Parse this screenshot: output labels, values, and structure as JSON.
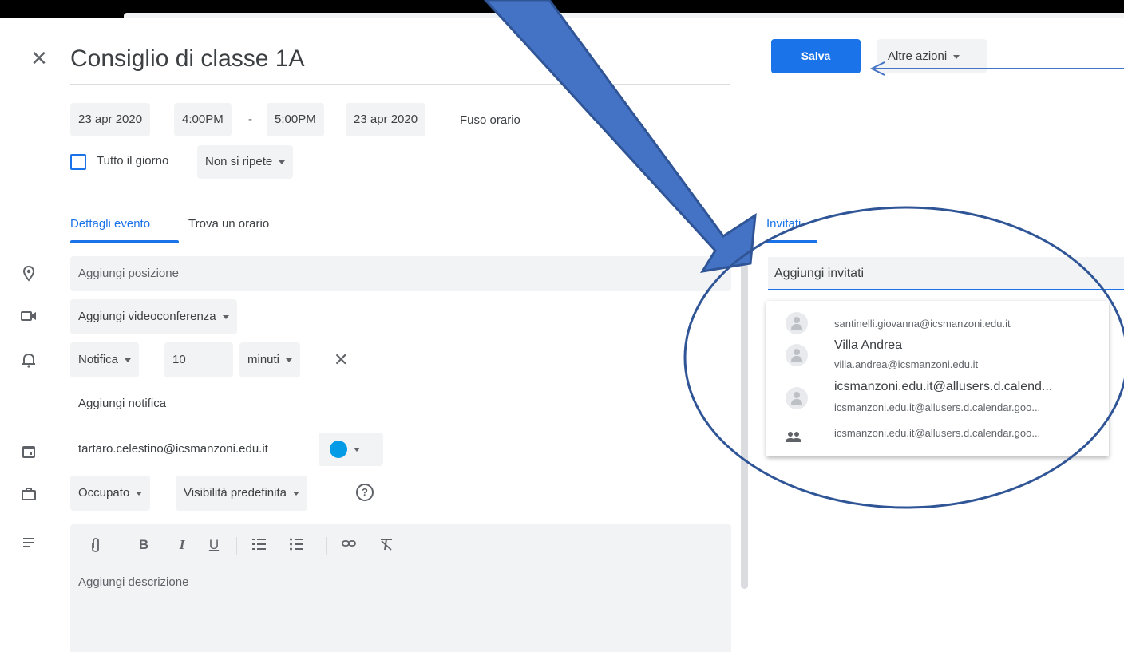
{
  "event": {
    "title": "Consiglio di classe 1A",
    "start_date": "23 apr 2020",
    "start_time": "4:00PM",
    "separator": "-",
    "end_time": "5:00PM",
    "end_date": "23 apr 2020",
    "timezone_label": "Fuso orario",
    "all_day_label": "Tutto il giorno",
    "repeat_label": "Non si ripete"
  },
  "tabs": {
    "details": "Dettagli evento",
    "find_time": "Trova un orario",
    "guests": "Invitati"
  },
  "details": {
    "location_placeholder": "Aggiungi posizione",
    "conference_label": "Aggiungi videoconferenza",
    "notification_type": "Notifica",
    "notification_value": "10",
    "notification_unit": "minuti",
    "add_notification": "Aggiungi notifica",
    "calendar_owner": "tartaro.celestino@icsmanzoni.edu.it",
    "calendar_color": "#039be5",
    "busy_label": "Occupato",
    "visibility_label": "Visibilità predefinita",
    "description_placeholder": "Aggiungi descrizione"
  },
  "actions": {
    "save": "Salva",
    "more": "Altre azioni"
  },
  "guests": {
    "input_placeholder": "Aggiungi invitati",
    "suggestions": [
      {
        "name": "",
        "email": "santinelli.giovanna@icsmanzoni.edu.it"
      },
      {
        "name": "Villa Andrea",
        "email": "villa.andrea@icsmanzoni.edu.it"
      },
      {
        "name": "icsmanzoni.edu.it@allusers.d.calend...",
        "email": "icsmanzoni.edu.it@allusers.d.calendar.goo..."
      },
      {
        "name": "",
        "email": "icsmanzoni.edu.it@allusers.d.calendar.goo..."
      }
    ]
  },
  "colors": {
    "accent": "#1a73e8",
    "annotation": "#4472c4",
    "annotation_outline": "#2f5597"
  }
}
